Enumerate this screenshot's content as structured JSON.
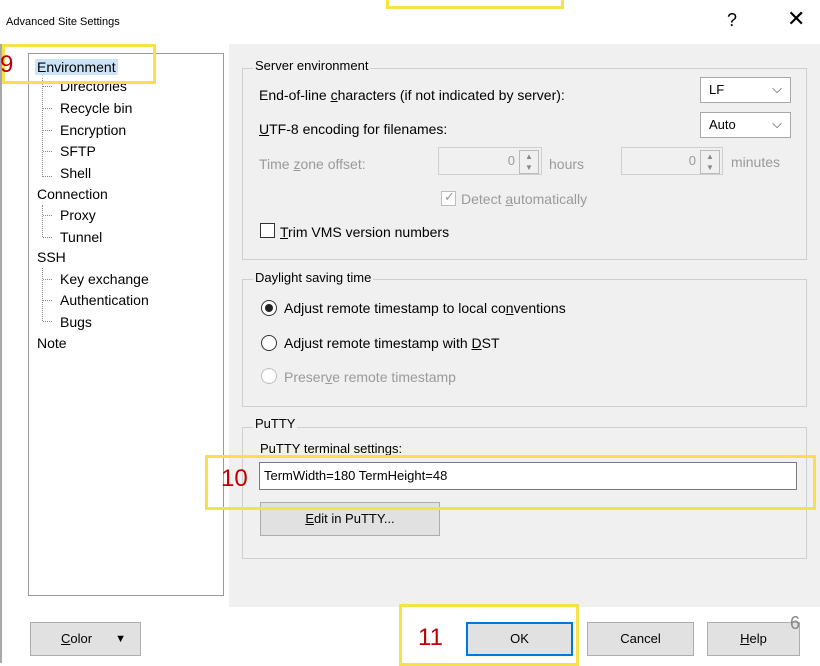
{
  "window": {
    "title": "Advanced Site Settings",
    "help_glyph": "?",
    "close_glyph": "✕"
  },
  "tree": {
    "items": [
      {
        "label": "Environment",
        "level": 0
      },
      {
        "label": "Directories",
        "level": 1
      },
      {
        "label": "Recycle bin",
        "level": 1
      },
      {
        "label": "Encryption",
        "level": 1
      },
      {
        "label": "SFTP",
        "level": 1
      },
      {
        "label": "Shell",
        "level": 1
      },
      {
        "label": "Connection",
        "level": 0
      },
      {
        "label": "Proxy",
        "level": 1
      },
      {
        "label": "Tunnel",
        "level": 1
      },
      {
        "label": "SSH",
        "level": 0
      },
      {
        "label": "Key exchange",
        "level": 1
      },
      {
        "label": "Authentication",
        "level": 1
      },
      {
        "label": "Bugs",
        "level": 1
      },
      {
        "label": "Note",
        "level": 0
      }
    ],
    "selected": "Environment"
  },
  "server_env": {
    "title": "Server environment",
    "eol_label_pre": "End-of-line ",
    "eol_label_u": "c",
    "eol_label_post": "haracters (if not indicated by server):",
    "eol_value": "LF",
    "utf8_label_u": "U",
    "utf8_label_post": "TF-8 encoding for filenames:",
    "utf8_value": "Auto",
    "tz_label_pre": "Time ",
    "tz_label_u": "z",
    "tz_label_post": "one offset:",
    "tz_hours_value": "0",
    "tz_hours_unit": "hours",
    "tz_minutes_value": "0",
    "tz_minutes_unit": "minutes",
    "detect_pre": "Detect ",
    "detect_u": "a",
    "detect_post": "utomatically",
    "trim_u": "T",
    "trim_post": "rim VMS version numbers",
    "dropdown_arrow": "⌵"
  },
  "dst": {
    "title": "Daylight saving time",
    "opt1_pre": "Adjust remote timestamp to local co",
    "opt1_u": "n",
    "opt1_post": "ventions",
    "opt2_pre": "Adjust remote timestamp with ",
    "opt2_u": "D",
    "opt2_post": "ST",
    "opt3_pre": "Preser",
    "opt3_u": "v",
    "opt3_post": "e remote timestamp"
  },
  "putty": {
    "title": "PuTTY",
    "settings_label": "PuTTY terminal settings:",
    "settings_value": "TermWidth=180 TermHeight=48",
    "edit_u": "E",
    "edit_post": "dit in PuTTY..."
  },
  "footer": {
    "color_u": "C",
    "color_post": "olor",
    "color_arrow": "▼",
    "ok": "OK",
    "cancel": "Cancel",
    "help_u": "H",
    "help_post": "elp"
  },
  "annotations": {
    "step9": "9",
    "step10": "10",
    "step11": "11",
    "page_number": "6"
  },
  "colors": {
    "highlight": "#f8e04a",
    "annotation_text": "#c00000",
    "selection": "#cce4f7",
    "default_button_border": "#0078d7"
  }
}
